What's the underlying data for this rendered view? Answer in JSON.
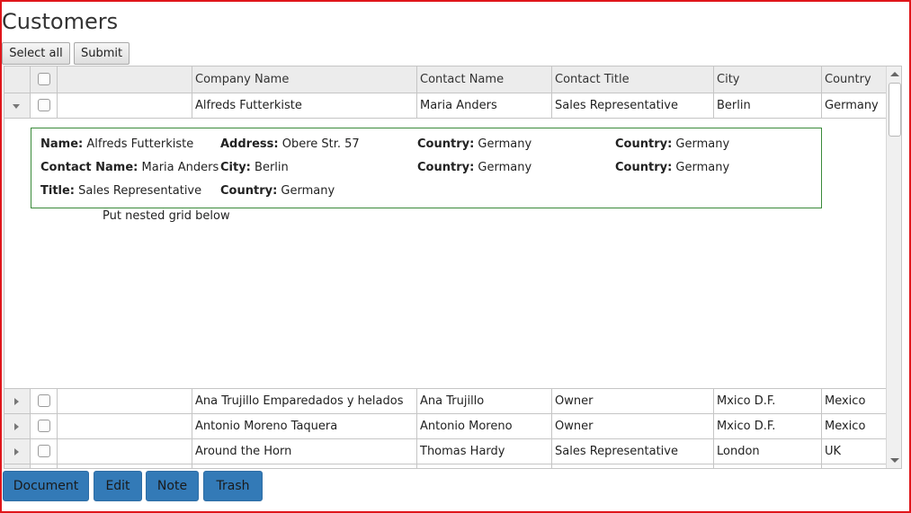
{
  "page": {
    "title": "Customers"
  },
  "toolbar": {
    "select_all": "Select all",
    "submit": "Submit"
  },
  "grid": {
    "columns": [
      "Company Name",
      "Contact Name",
      "Contact Title",
      "City",
      "Country"
    ],
    "rows": [
      {
        "company": "Alfreds Futterkiste",
        "contact": "Maria Anders",
        "title": "Sales Representative",
        "city": "Berlin",
        "country": "Germany",
        "expanded": true
      },
      {
        "company": "Ana Trujillo Emparedados y helados",
        "contact": "Ana Trujillo",
        "title": "Owner",
        "city": "Mxico D.F.",
        "country": "Mexico",
        "expanded": false
      },
      {
        "company": "Antonio Moreno Taquera",
        "contact": "Antonio Moreno",
        "title": "Owner",
        "city": "Mxico D.F.",
        "country": "Mexico",
        "expanded": false
      },
      {
        "company": "Around the Horn",
        "contact": "Thomas Hardy",
        "title": "Sales Representative",
        "city": "London",
        "country": "UK",
        "expanded": false
      }
    ]
  },
  "detail": {
    "name_label": "Name:",
    "name_value": "Alfreds Futterkiste",
    "contact_label": "Contact Name:",
    "contact_value": "Maria Anders",
    "title_label": "Title:",
    "title_value": "Sales Representative",
    "address_label": "Address:",
    "address_value": "Obere Str. 57",
    "city_label": "City:",
    "city_value": "Berlin",
    "country_label": "Country:",
    "country_value": "Germany",
    "nested_note": "Put nested grid below"
  },
  "actions": {
    "document": "Document",
    "edit": "Edit",
    "note": "Note",
    "trash": "Trash"
  },
  "colors": {
    "frame_border": "#e0161b",
    "action_button": "#337ab7",
    "detail_border": "#3a8a3a",
    "header_bg": "#ececec"
  }
}
